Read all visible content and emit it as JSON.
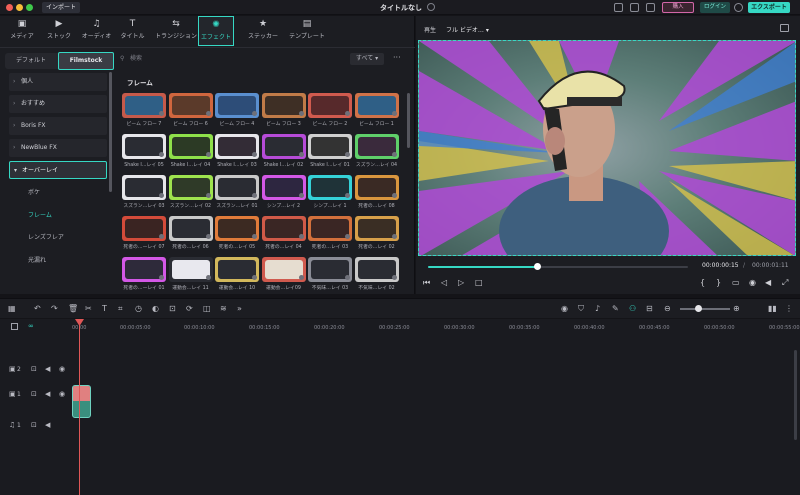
{
  "titlebar": {
    "import_label": "インポート",
    "doc_title": "タイトルなし",
    "buy_label": "購入",
    "login_label": "ログイン",
    "export_label": "エクスポート"
  },
  "tabs": [
    {
      "label": "メディア",
      "icon": "media-icon"
    },
    {
      "label": "ストック",
      "icon": "stock-icon"
    },
    {
      "label": "オーディオ",
      "icon": "music-icon"
    },
    {
      "label": "タイトル",
      "icon": "title-icon"
    },
    {
      "label": "トランジション",
      "icon": "transition-icon"
    },
    {
      "label": "エフェクト",
      "icon": "effects-icon"
    },
    {
      "label": "ステッカー",
      "icon": "sticker-icon"
    },
    {
      "label": "テンプレート",
      "icon": "template-icon"
    }
  ],
  "sidebar": {
    "seg_default": "デフォルト",
    "seg_filmstock": "Filmstock",
    "categories": [
      "個人",
      "おすすめ",
      "Boris FX",
      "NewBlue FX",
      "オーバーレイ"
    ],
    "subs": [
      "ボケ",
      "フレーム",
      "レンズフレア",
      "光漏れ"
    ]
  },
  "content": {
    "search_placeholder": "検索",
    "filter_label": "すべて",
    "section_title": "フレーム",
    "items": [
      "ビーム フロー 7",
      "ビーム フロー 6",
      "ビーム フロー 4",
      "ビーム フロー 3",
      "ビーム フロー 2",
      "ビーム フロー 1",
      "Shake I…レイ 05",
      "Shake I…レイ 04",
      "Shake I…レイ 03",
      "Shake I…レイ 02",
      "Shake I…レイ 01",
      "スズラン…レイ 04",
      "スズラン…レイ 03",
      "スズラン…レイ 02",
      "スズラン…レイ 01",
      "シンプ…レイ 2",
      "シンプ…レイ 1",
      "死者の…レイ 08",
      "死者の…ーレイ 07",
      "死者の…レイ 06",
      "死者の…レイ 05",
      "死者の…レイ 04",
      "死者の…レイ 03",
      "死者の…レイ 02",
      "死者の…ーレイ 01",
      "運動会…レイ 11",
      "運動会…レイ 10",
      "運動会…レイ09",
      "不気味…レイ 03",
      "不気味…レイ 02"
    ]
  },
  "preview": {
    "label": "再生",
    "quality": "フル ビデオ…",
    "current_time": "00:00:00:15",
    "separator": "/",
    "total_time": "00:00:01:11",
    "progress": 0.42
  },
  "timeline": {
    "ruler": [
      "00:00",
      "00:00:05:00",
      "00:00:10:00",
      "00:00:15:00",
      "00:00:20:00",
      "00:00:25:00",
      "00:00:30:00",
      "00:00:35:00",
      "00:00:40:00",
      "00:00:45:00",
      "00:00:50:00",
      "00:00:55:00"
    ],
    "tracks": [
      {
        "label": "2",
        "kind": "video"
      },
      {
        "label": "1",
        "kind": "video"
      },
      {
        "label": "1",
        "kind": "audio"
      }
    ]
  },
  "colors": {
    "accent": "#36d8c4",
    "playhead": "#e05757",
    "buy": "#d266a8"
  }
}
